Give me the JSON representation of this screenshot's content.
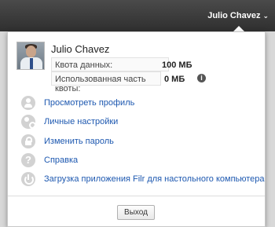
{
  "topbar": {
    "user_name": "Julio Chavez",
    "chevron": "⌄"
  },
  "profile": {
    "name": "Julio Chavez",
    "quota": {
      "data_label": "Квота данных:",
      "data_value": "100 МБ",
      "used_label": "Использованная часть квоты:",
      "used_value": "0 МБ"
    },
    "info_icon": "i"
  },
  "menu": {
    "items": [
      {
        "label": "Просмотреть профиль",
        "icon": "person-icon"
      },
      {
        "label": "Личные настройки",
        "icon": "settings-icon"
      },
      {
        "label": "Изменить пароль",
        "icon": "lock-icon"
      },
      {
        "label": "Справка",
        "icon": "help-icon"
      },
      {
        "label": "Загрузка приложения Filr для настольного компьютера",
        "icon": "power-icon"
      }
    ],
    "help_glyph": "?"
  },
  "logout_label": "Выход",
  "colors": {
    "link": "#1d58b0",
    "topbar": "#3a3a3a",
    "icon_bg": "#d2d2d2"
  }
}
